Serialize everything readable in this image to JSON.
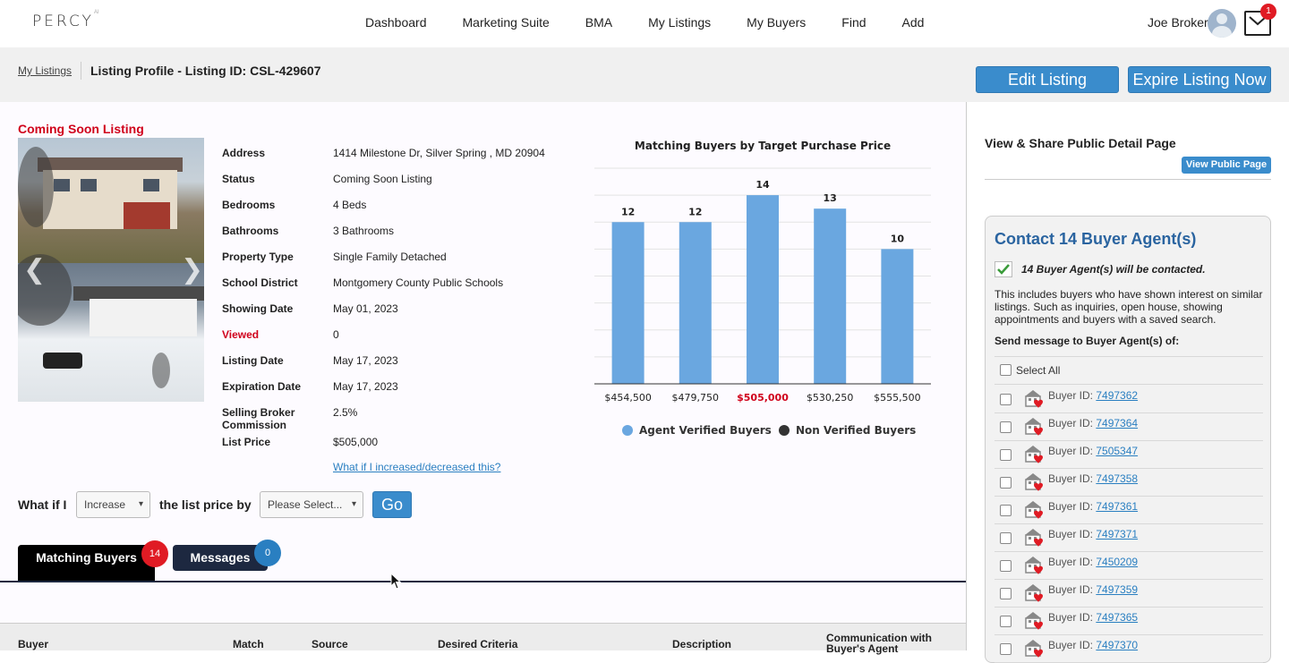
{
  "brand": {
    "logo": "PERCY",
    "logo_sup": "AI"
  },
  "nav": [
    "Dashboard",
    "Marketing Suite",
    "BMA",
    "My Listings",
    "My Buyers",
    "Find",
    "Add"
  ],
  "user": {
    "name": "Joe Broker",
    "mail_count": "1"
  },
  "breadcrumb": {
    "link": "My Listings",
    "title": "Listing Profile - Listing ID: CSL-429607"
  },
  "actions": {
    "edit": "Edit Listing",
    "expire": "Expire Listing Now"
  },
  "listing": {
    "badge": "Coming Soon Listing",
    "fields": [
      {
        "label": "Address",
        "value": "1414 Milestone Dr, Silver Spring , MD 20904"
      },
      {
        "label": "Status",
        "value": "Coming Soon Listing"
      },
      {
        "label": "Bedrooms",
        "value": "4 Beds"
      },
      {
        "label": "Bathrooms",
        "value": "3 Bathrooms"
      },
      {
        "label": "Property Type",
        "value": "Single Family Detached"
      },
      {
        "label": "School District",
        "value": "Montgomery County Public Schools"
      },
      {
        "label": "Showing Date",
        "value": "May 01, 2023"
      },
      {
        "label": "Viewed",
        "value": "0"
      },
      {
        "label": "Listing Date",
        "value": "May 17, 2023"
      },
      {
        "label": "Expiration Date",
        "value": "May 17, 2023"
      },
      {
        "label": "Selling Broker Commission",
        "value": "2.5%"
      },
      {
        "label": "List Price",
        "value": "$505,000"
      }
    ],
    "whatif_link": "What if I increased/decreased this?"
  },
  "whatif": {
    "prefix": "What if I",
    "direction": "Increase",
    "middle": "the list price by",
    "amount_placeholder": "Please Select...",
    "go": "Go"
  },
  "tabs": [
    {
      "label": "Matching Buyers",
      "count": "14"
    },
    {
      "label": "Messages",
      "count": "0"
    }
  ],
  "table_headers": [
    "Buyer",
    "Match",
    "Source",
    "Desired Criteria",
    "Description",
    "Communication with Buyer's Agent"
  ],
  "chart_data": {
    "type": "bar",
    "title": "Matching Buyers by Target Purchase Price",
    "categories": [
      "$454,500",
      "$479,750",
      "$505,000",
      "$530,250",
      "$555,500"
    ],
    "highlight_category": "$505,000",
    "series": [
      {
        "name": "Agent Verified Buyers",
        "values": [
          12,
          12,
          14,
          13,
          10
        ],
        "color": "#6aa7e0"
      },
      {
        "name": "Non Verified Buyers",
        "values": [
          0,
          0,
          0,
          0,
          0
        ],
        "color": "#333333"
      }
    ],
    "ylim": [
      0,
      16
    ],
    "grid": true,
    "legend": "bottom",
    "highlight_color": "#d0021b"
  },
  "sidebar": {
    "share_title": "View & Share Public Detail Page",
    "public_btn": "View Public Page",
    "contact_title": "Contact 14 Buyer Agent(s)",
    "contacted": "14 Buyer Agent(s) will be contacted.",
    "includes": "This includes buyers who have shown interest on similar listings. Such as inquiries, open house, showing appointments and buyers with a saved search.",
    "send_to": "Send message to Buyer Agent(s) of:",
    "select_all": "Select All",
    "buyer_prefix": "Buyer ID:",
    "buyers": [
      "7497362",
      "7497364",
      "7505347",
      "7497358",
      "7497361",
      "7497371",
      "7450209",
      "7497359",
      "7497365",
      "7497370"
    ]
  }
}
